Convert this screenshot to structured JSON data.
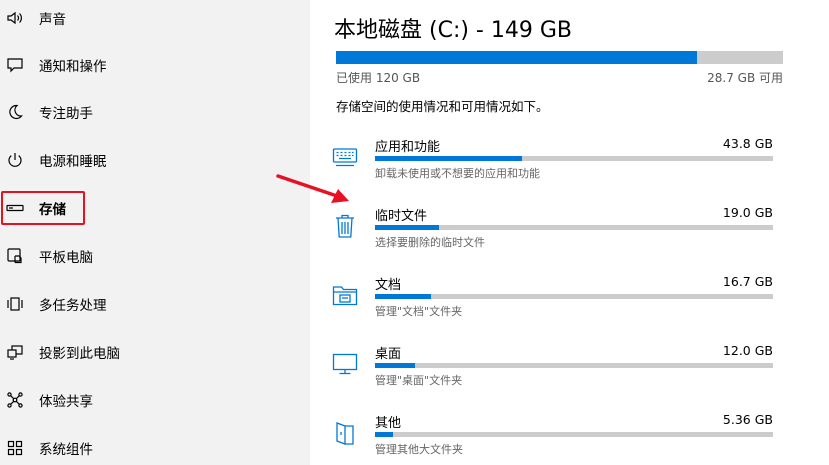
{
  "sidebar": {
    "items": [
      {
        "label": "声音",
        "icon": "speaker-icon"
      },
      {
        "label": "通知和操作",
        "icon": "notification-icon"
      },
      {
        "label": "专注助手",
        "icon": "moon-icon"
      },
      {
        "label": "电源和睡眠",
        "icon": "power-icon"
      },
      {
        "label": "存储",
        "icon": "storage-icon"
      },
      {
        "label": "平板电脑",
        "icon": "tablet-icon"
      },
      {
        "label": "多任务处理",
        "icon": "multitask-icon"
      },
      {
        "label": "投影到此电脑",
        "icon": "project-icon"
      },
      {
        "label": "体验共享",
        "icon": "share-icon"
      },
      {
        "label": "系统组件",
        "icon": "components-icon"
      }
    ],
    "selected_index": 4
  },
  "main": {
    "title": "本地磁盘 (C:) - 149 GB",
    "used_label": "已使用 120 GB",
    "free_label": "28.7 GB 可用",
    "used_fraction": 0.807,
    "description": "存储空间的使用情况和可用情况如下。",
    "categories": [
      {
        "name": "应用和功能",
        "size": "43.8 GB",
        "subtitle": "卸载未使用或不想要的应用和功能",
        "fraction": 0.37,
        "icon": "keyboard-icon"
      },
      {
        "name": "临时文件",
        "size": "19.0 GB",
        "subtitle": "选择要删除的临时文件",
        "fraction": 0.16,
        "icon": "trash-icon"
      },
      {
        "name": "文档",
        "size": "16.7 GB",
        "subtitle": "管理\"文档\"文件夹",
        "fraction": 0.14,
        "icon": "folder-icon"
      },
      {
        "name": "桌面",
        "size": "12.0 GB",
        "subtitle": "管理\"桌面\"文件夹",
        "fraction": 0.1,
        "icon": "monitor-icon"
      },
      {
        "name": "其他",
        "size": "5.36 GB",
        "subtitle": "管理其他大文件夹",
        "fraction": 0.045,
        "icon": "other-folder-icon"
      }
    ]
  },
  "colors": {
    "accent": "#0078d7",
    "bar_track": "#cccccc",
    "annotation": "#e81123"
  }
}
